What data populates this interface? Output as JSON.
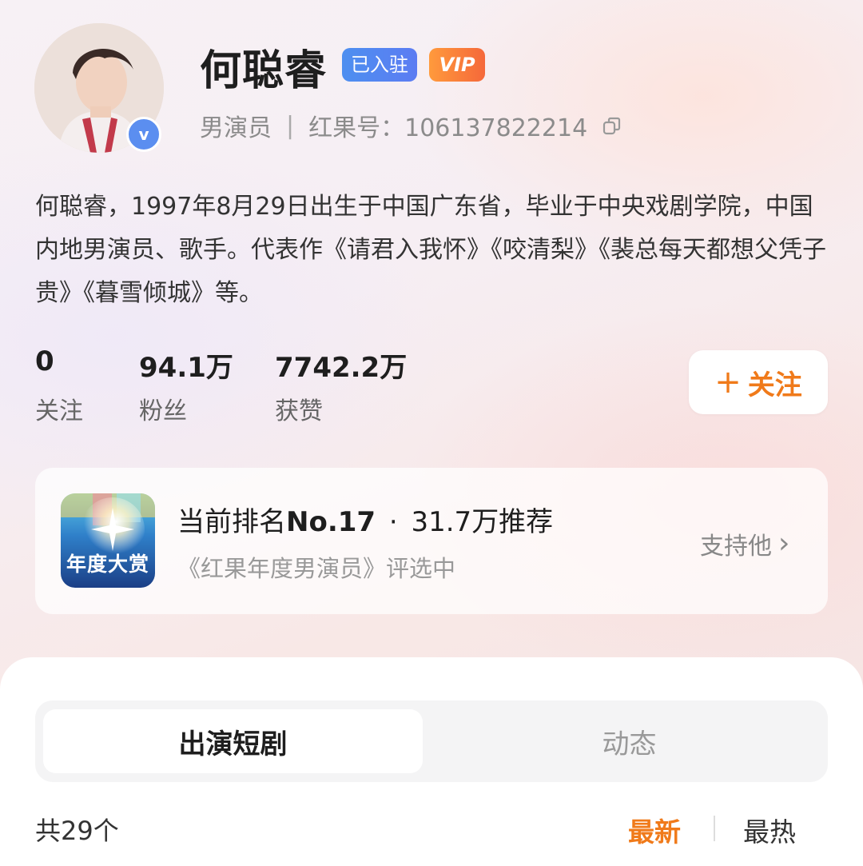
{
  "profile": {
    "name": "何聪睿",
    "badge_settled": "已入驻",
    "badge_vip": "VIP",
    "verified_mark": "v",
    "role": "男演员",
    "separator": "|",
    "id_label": "红果号：",
    "id_value": "106137822214",
    "bio": "何聪睿，1997年8月29日出生于中国广东省，毕业于中央戏剧学院，中国内地男演员、歌手。代表作《请君入我怀》《咬清梨》《裴总每天都想父凭子贵》《暮雪倾城》等。"
  },
  "stats": [
    {
      "value": "0",
      "label": "关注"
    },
    {
      "value": "94.1万",
      "label": "粉丝"
    },
    {
      "value": "7742.2万",
      "label": "获赞"
    }
  ],
  "follow_button": {
    "icon": "+",
    "label": "关注"
  },
  "ranking": {
    "icon_text": "年度大赏",
    "rank_prefix": "当前排名",
    "rank_value": "No.17",
    "dot": "·",
    "recommend": "31.7万推荐",
    "event": "《红果年度男演员》评选中",
    "support_label": "支持他",
    "support_arrow": "›"
  },
  "tabs": [
    {
      "label": "出演短剧",
      "active": true
    },
    {
      "label": "动态",
      "active": false
    }
  ],
  "list": {
    "count_label": "共29个",
    "sort_new": "最新",
    "sort_hot": "最热"
  },
  "colors": {
    "accent_orange": "#f07a1a",
    "badge_blue": "#4d8ff0",
    "vip_orange": "#f5683a",
    "verified_blue": "#5b8ef0"
  }
}
